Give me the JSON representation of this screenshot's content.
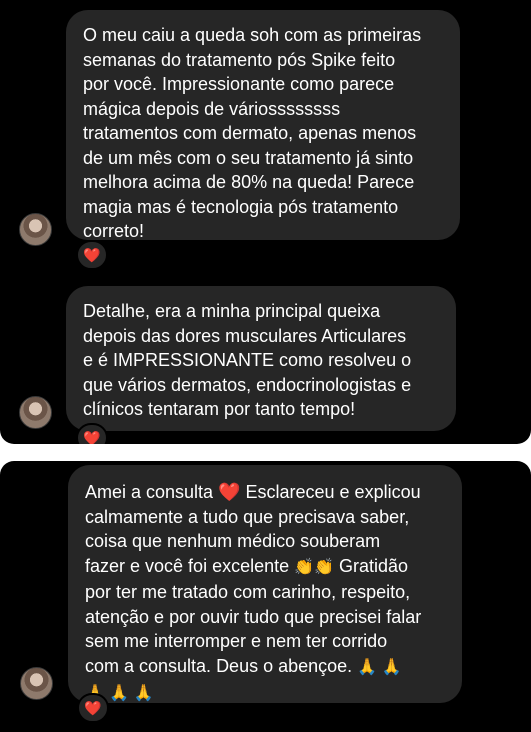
{
  "messages": [
    {
      "text": "O meu caiu a queda soh com as primeiras\nsemanas do tratamento pós Spike feito\npor você. Impressionante como parece\nmágica depois de váriossssssss\ntratamentos com dermato, apenas menos\nde um mês com o seu tratamento já sinto\nmelhora acima de 80% na queda! Parece\nmagia mas é tecnologia pós tratamento\ncorreto!",
      "reaction": "❤️"
    },
    {
      "text": "Detalhe, era a minha principal queixa\ndepois das dores musculares Articulares\ne é IMPRESSIONANTE como resolveu o\nque vários dermatos, endocrinologistas e\nclínicos tentaram por tanto tempo!",
      "reaction": "❤️"
    },
    {
      "line1_a": "Amei a consulta ",
      "line1_heart": "❤️",
      "line1_b": " Esclareceu e explicou",
      "line2": "calmamente a tudo que precisava saber,",
      "line3": "coisa que nenhum médico souberam",
      "line4_a": "fazer e você foi excelente ",
      "line4_claps": "👏👏",
      "line4_b": " Gratidão",
      "line5": "por ter me tratado com carinho, respeito,",
      "line6": "atenção e por ouvir tudo que precisei falar",
      "line7": "sem me interromper e nem ter corrido",
      "line8_a": "com a consulta. Deus o abençoe. ",
      "line8_prays": "🙏 🙏",
      "line9_prays": "🙏 🙏 🙏",
      "reaction": "❤️"
    }
  ],
  "colors": {
    "background": "#000000",
    "bubble": "#262626",
    "text": "#ffffff",
    "heart": "#ff1f3d"
  },
  "icons": {
    "reaction": "heart-icon",
    "avatar": "avatar"
  }
}
